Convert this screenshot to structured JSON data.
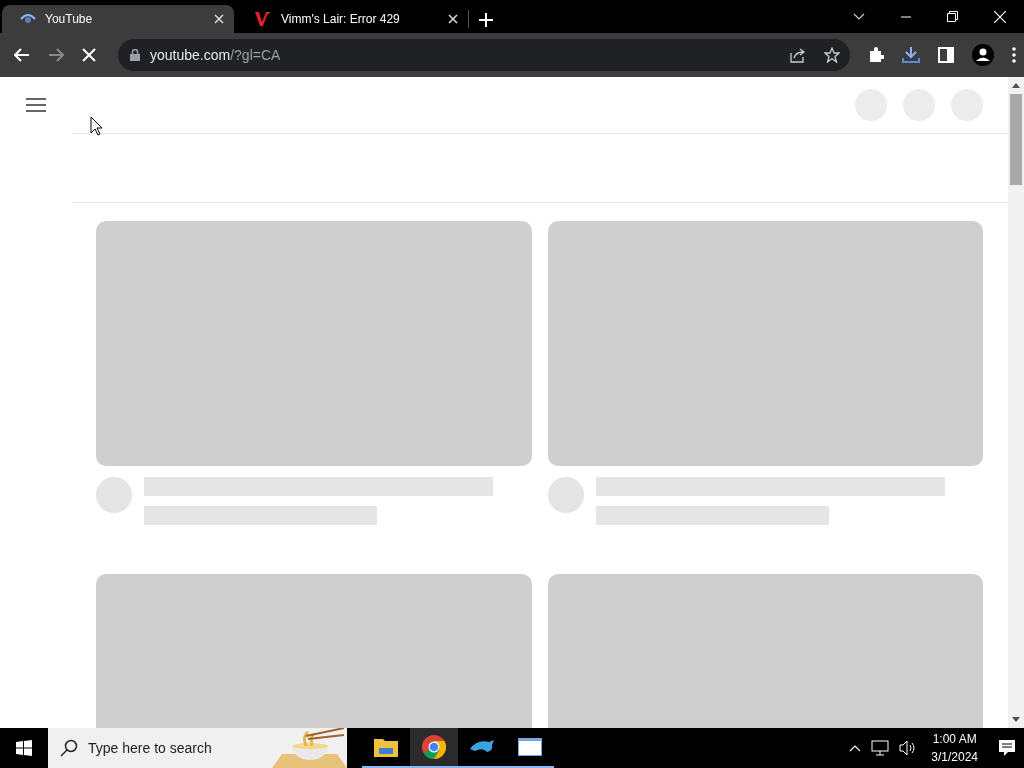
{
  "tabs": [
    {
      "title": "YouTube",
      "kind": "youtube",
      "selected": true
    },
    {
      "title": "Vimm's Lair: Error 429",
      "kind": "vimm",
      "selected": false
    }
  ],
  "toolbar": {
    "loading": true,
    "host": "youtube.com",
    "path": "/?gl=CA"
  },
  "taskbar": {
    "search_placeholder": "Type here to search",
    "apps": [
      {
        "kind": "explorer",
        "selected": false,
        "running": true
      },
      {
        "kind": "chrome",
        "selected": true,
        "running": true
      },
      {
        "kind": "dolphin",
        "selected": false,
        "running": true
      },
      {
        "kind": "window",
        "selected": false,
        "running": true
      }
    ],
    "time": "1:00 AM",
    "date": "3/1/2024"
  }
}
